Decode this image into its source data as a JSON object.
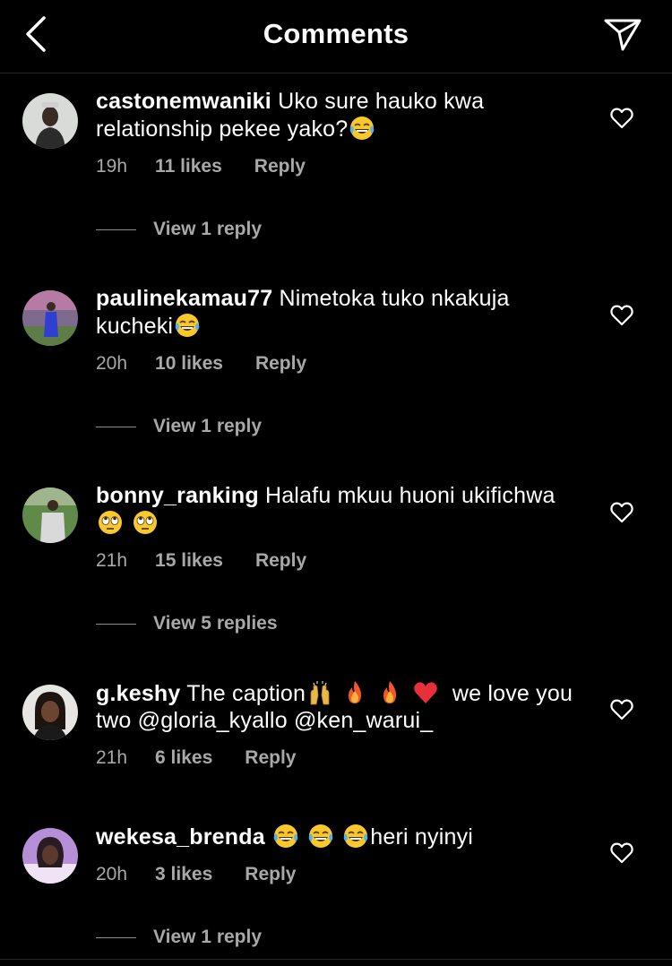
{
  "header": {
    "title": "Comments",
    "back_icon": "chevron-left-icon",
    "share_icon": "send-icon"
  },
  "colors": {
    "background": "#000000",
    "text_primary": "#ffffff",
    "text_secondary": "#a8a8a8"
  },
  "comments": [
    {
      "username": "castonemwaniki",
      "text_parts": [
        "Uko sure hauko kwa relationship pekee yako?"
      ],
      "emojis": [
        "tears-of-joy"
      ],
      "time": "19h",
      "likes": "11 likes",
      "reply_label": "Reply",
      "view_replies": "View 1 reply"
    },
    {
      "username": "paulinekamau77",
      "text_parts": [
        "Nimetoka tuko nkakuja kucheki"
      ],
      "emojis": [
        "tears-of-joy"
      ],
      "time": "20h",
      "likes": "10 likes",
      "reply_label": "Reply",
      "view_replies": "View 1 reply"
    },
    {
      "username": "bonny_ranking",
      "text_parts": [
        "Halafu mkuu huoni ukifichwa"
      ],
      "emojis": [
        "rolling-eyes",
        "rolling-eyes"
      ],
      "time": "21h",
      "likes": "15 likes",
      "reply_label": "Reply",
      "view_replies": "View 5 replies"
    },
    {
      "username": "g.keshy",
      "text_parts": [
        "The caption",
        "we love you two @gloria_kyallo @ken_warui_"
      ],
      "emojis": [
        "raising-hands",
        "fire",
        "fire",
        "red-heart"
      ],
      "time": "21h",
      "likes": "6 likes",
      "reply_label": "Reply",
      "view_replies": ""
    },
    {
      "username": "wekesa_brenda",
      "text_parts": [
        "heri nyinyi"
      ],
      "emojis": [
        "tears-of-joy",
        "tears-of-joy",
        "tears-of-joy"
      ],
      "time": "20h",
      "likes": "3 likes",
      "reply_label": "Reply",
      "view_replies": "View 1 reply"
    }
  ]
}
